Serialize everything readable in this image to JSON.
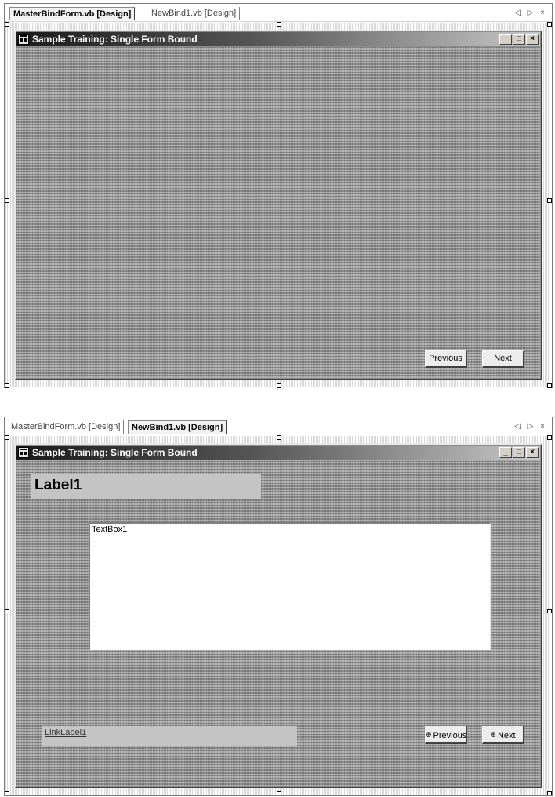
{
  "panels": [
    {
      "tabs": [
        {
          "label": "MasterBindForm.vb [Design]",
          "active": true
        },
        {
          "label": "NewBind1.vb [Design]",
          "active": false
        }
      ],
      "tab_controls": {
        "prev": "◁",
        "next": "▷",
        "close": "×"
      },
      "form": {
        "title": "Sample Training: Single Form Bound",
        "window_buttons": {
          "minimize": "_",
          "maximize": "□",
          "close": "×"
        },
        "previous_button": "Previous",
        "next_button": "Next"
      }
    },
    {
      "tabs": [
        {
          "label": "MasterBindForm.vb [Design]",
          "active": false
        },
        {
          "label": "NewBind1.vb [Design]",
          "active": true
        }
      ],
      "tab_controls": {
        "prev": "◁",
        "next": "▷",
        "close": "×"
      },
      "form": {
        "title": "Sample Training: Single Form Bound",
        "window_buttons": {
          "minimize": "_",
          "maximize": "□",
          "close": "×"
        },
        "label1": "Label1",
        "textbox1": "TextBox1",
        "linklabel1": "LinkLabel1",
        "previous_button": "Previous",
        "next_button": "Next",
        "nav_glyphs": {
          "previous": "⊕",
          "next": "⊕"
        }
      }
    }
  ]
}
